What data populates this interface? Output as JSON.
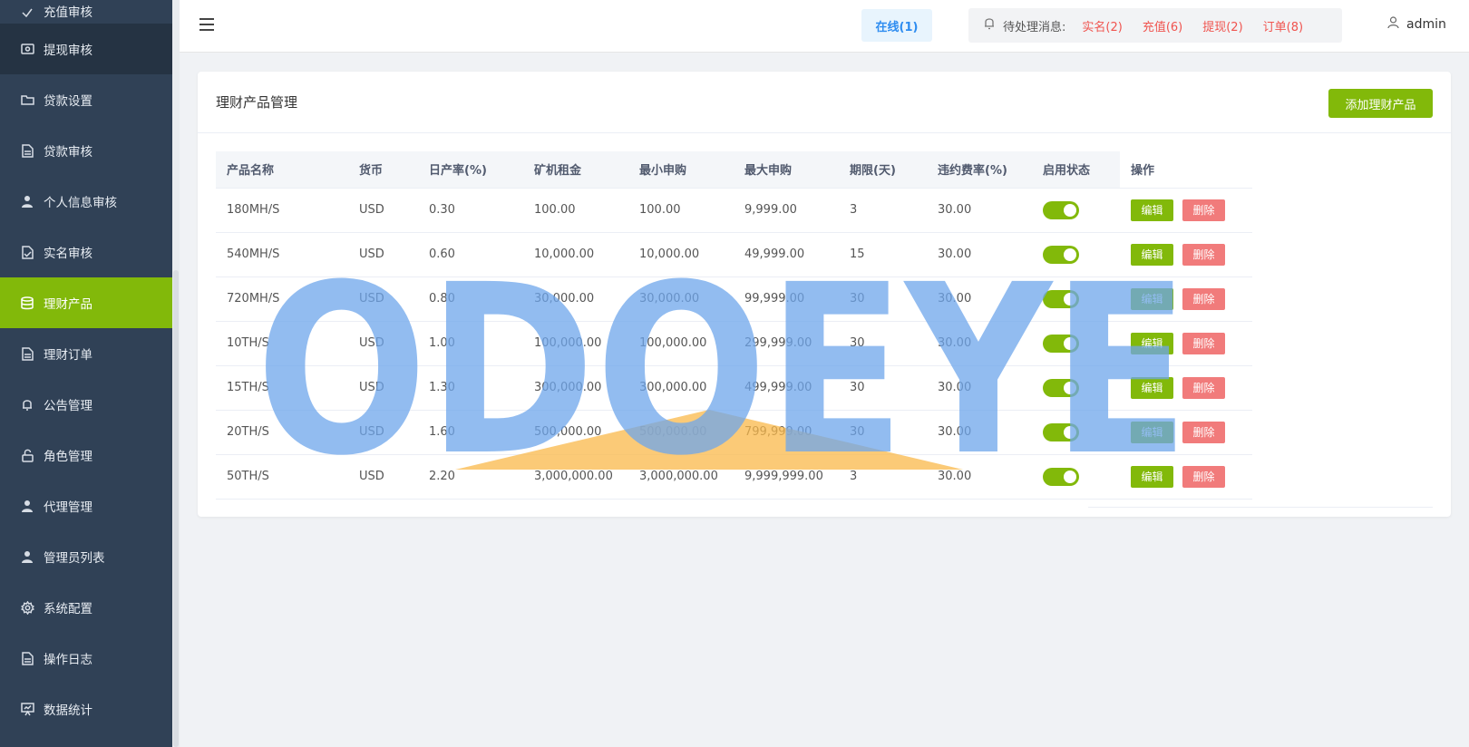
{
  "sidebar": {
    "items": [
      {
        "label": "充值审核",
        "icon": "check-icon",
        "state": "partial"
      },
      {
        "label": "提现审核",
        "icon": "wallet-icon",
        "state": "dark"
      },
      {
        "label": "贷款设置",
        "icon": "folder-icon",
        "state": "normal"
      },
      {
        "label": "贷款审核",
        "icon": "document-icon",
        "state": "normal"
      },
      {
        "label": "个人信息审核",
        "icon": "user-icon",
        "state": "normal"
      },
      {
        "label": "实名审核",
        "icon": "doc-check-icon",
        "state": "normal"
      },
      {
        "label": "理财产品",
        "icon": "database-icon",
        "state": "active"
      },
      {
        "label": "理财订单",
        "icon": "document-icon",
        "state": "normal"
      },
      {
        "label": "公告管理",
        "icon": "bell-icon",
        "state": "normal"
      },
      {
        "label": "角色管理",
        "icon": "lock-icon",
        "state": "normal"
      },
      {
        "label": "代理管理",
        "icon": "user-icon",
        "state": "normal"
      },
      {
        "label": "管理员列表",
        "icon": "user-icon",
        "state": "normal"
      },
      {
        "label": "系统配置",
        "icon": "gear-icon",
        "state": "normal"
      },
      {
        "label": "操作日志",
        "icon": "document-icon",
        "state": "normal"
      },
      {
        "label": "数据统计",
        "icon": "chart-board-icon",
        "state": "normal"
      }
    ]
  },
  "header": {
    "online": "在线(1)",
    "pending_label": "待处理消息:",
    "pending_links": [
      "实名(2)",
      "充值(6)",
      "提现(2)",
      "订单(8)"
    ],
    "username": "admin"
  },
  "card": {
    "title": "理财产品管理",
    "add_button": "添加理财产品"
  },
  "table": {
    "headers": [
      "产品名称",
      "货币",
      "日产率(%)",
      "矿机租金",
      "最小申购",
      "最大申购",
      "期限(天)",
      "违约费率(%)",
      "启用状态",
      "操作"
    ],
    "edit_label": "编辑",
    "delete_label": "删除",
    "rows": [
      {
        "name": "180MH/S",
        "currency": "USD",
        "rate": "0.30",
        "rent": "100.00",
        "min": "100.00",
        "max": "9,999.00",
        "days": "3",
        "penalty": "30.00",
        "enabled": true
      },
      {
        "name": "540MH/S",
        "currency": "USD",
        "rate": "0.60",
        "rent": "10,000.00",
        "min": "10,000.00",
        "max": "49,999.00",
        "days": "15",
        "penalty": "30.00",
        "enabled": true
      },
      {
        "name": "720MH/S",
        "currency": "USD",
        "rate": "0.80",
        "rent": "30,000.00",
        "min": "30,000.00",
        "max": "99,999.00",
        "days": "30",
        "penalty": "30.00",
        "enabled": true
      },
      {
        "name": "10TH/S",
        "currency": "USD",
        "rate": "1.00",
        "rent": "100,000.00",
        "min": "100,000.00",
        "max": "299,999.00",
        "days": "30",
        "penalty": "30.00",
        "enabled": true
      },
      {
        "name": "15TH/S",
        "currency": "USD",
        "rate": "1.30",
        "rent": "300,000.00",
        "min": "300,000.00",
        "max": "499,999.00",
        "days": "30",
        "penalty": "30.00",
        "enabled": true
      },
      {
        "name": "20TH/S",
        "currency": "USD",
        "rate": "1.60",
        "rent": "500,000.00",
        "min": "500,000.00",
        "max": "799,999.00",
        "days": "30",
        "penalty": "30.00",
        "enabled": true
      },
      {
        "name": "50TH/S",
        "currency": "USD",
        "rate": "2.20",
        "rent": "3,000,000.00",
        "min": "3,000,000.00",
        "max": "9,999,999.00",
        "days": "3",
        "penalty": "30.00",
        "enabled": true
      }
    ]
  },
  "watermark": {
    "text": "ODOEYE",
    "color": "#6ea6ec",
    "accent": "#f9b84a"
  },
  "colors": {
    "sidebar_bg": "#304156",
    "accent_green": "#82b90a",
    "danger": "#f17b7b",
    "link_red": "#f0544f",
    "online_blue": "#2d8cf0"
  }
}
